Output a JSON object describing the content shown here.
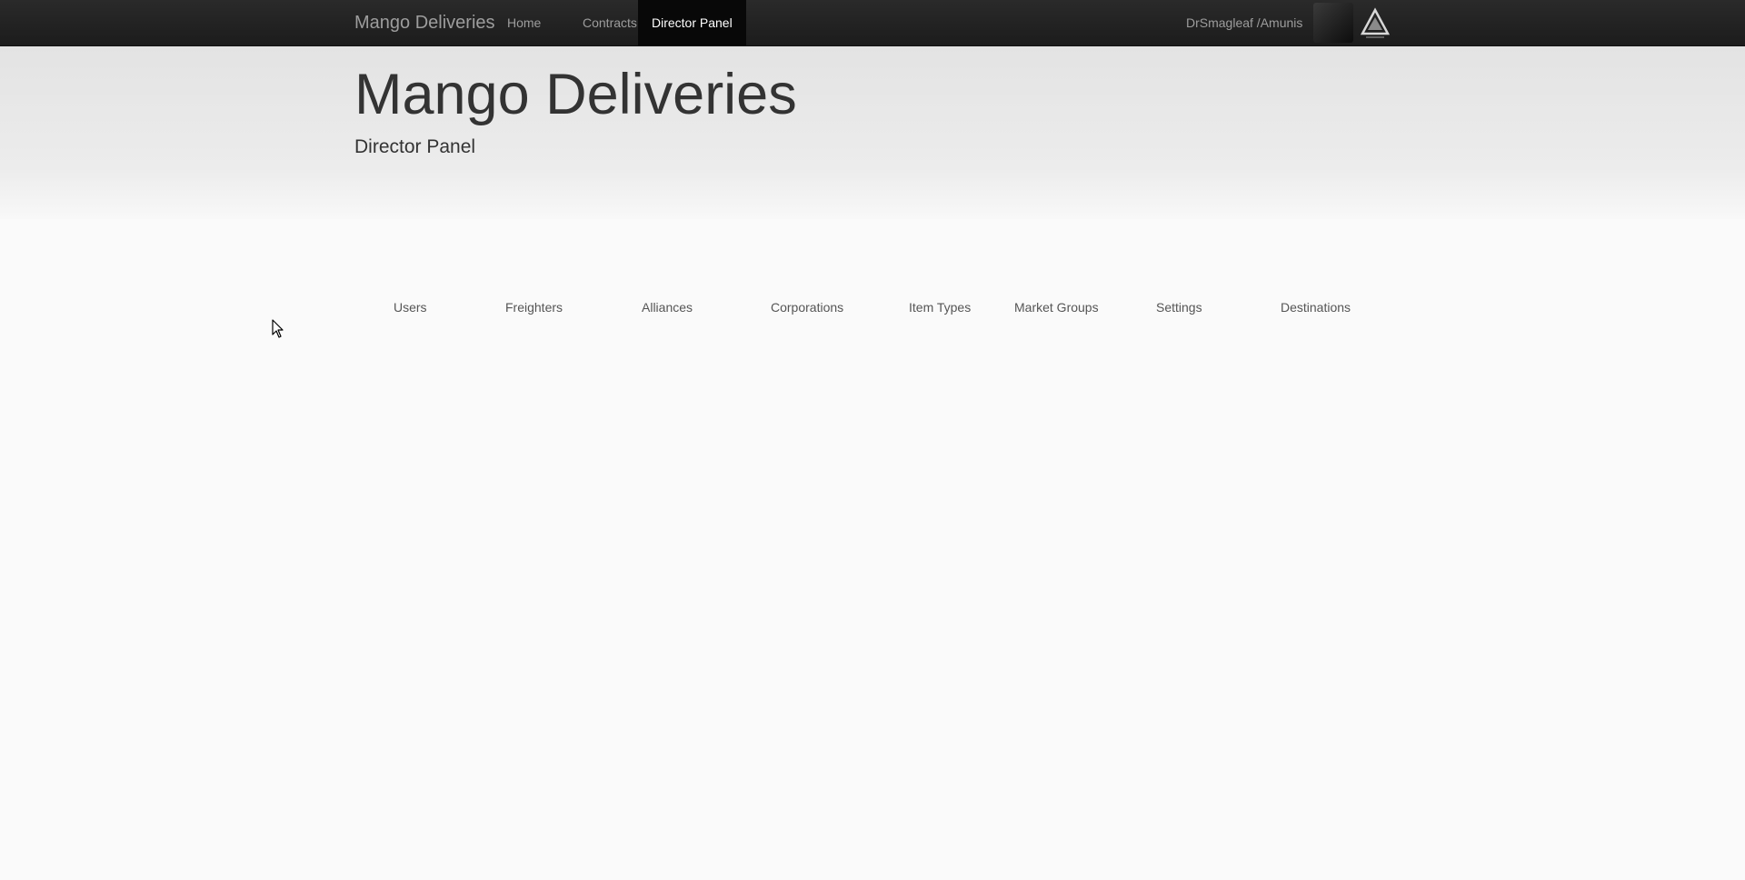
{
  "navbar": {
    "brand": "Mango Deliveries",
    "links": [
      {
        "label": "Home",
        "active": false
      },
      {
        "label": "Contracts",
        "active": false
      },
      {
        "label": "Director Panel",
        "active": true
      }
    ],
    "user": "DrSmagleaf /Amunis"
  },
  "header": {
    "title": "Mango Deliveries",
    "subtitle": "Director Panel"
  },
  "tabs": [
    {
      "label": "Users"
    },
    {
      "label": "Freighters"
    },
    {
      "label": "Alliances"
    },
    {
      "label": "Corporations"
    },
    {
      "label": "Item Types"
    },
    {
      "label": "Market Groups"
    },
    {
      "label": "Settings"
    },
    {
      "label": "Destinations"
    }
  ],
  "colors": {
    "navbar_bg": "#222222",
    "navbar_text": "#9d9d9d",
    "active_link_bg": "#080808",
    "page_bg": "#fafafa",
    "jumbotron_bg": "#eeeeee"
  },
  "icons": {
    "avatar": "user-avatar",
    "alliance_logo": "alliance-logo-icon",
    "cursor": "mouse-cursor-icon"
  }
}
